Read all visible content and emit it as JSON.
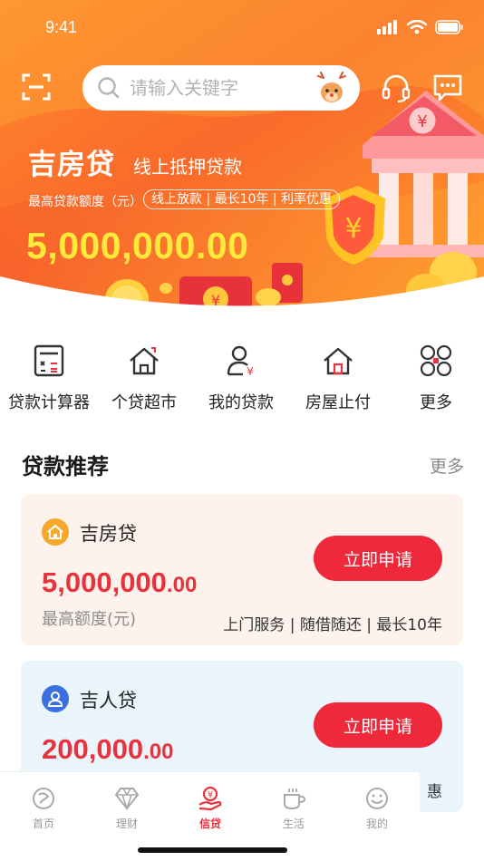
{
  "status_bar": {
    "time": "9:41"
  },
  "search": {
    "placeholder": "请输入关键字"
  },
  "hero": {
    "title": "吉房贷",
    "subtitle": "线上抵押贷款",
    "limit_label": "最高贷款额度（元）",
    "tags": "线上放款 | 最长10年 | 利率优惠",
    "amount": "5,000,000.00"
  },
  "quick_nav": [
    {
      "label": "贷款计算器",
      "icon": "calculator-icon"
    },
    {
      "label": "个贷超市",
      "icon": "house-icon"
    },
    {
      "label": "我的贷款",
      "icon": "user-yuan-icon"
    },
    {
      "label": "房屋止付",
      "icon": "house-stop-icon"
    },
    {
      "label": "更多",
      "icon": "grid-icon"
    }
  ],
  "recommend": {
    "title": "贷款推荐",
    "more": "更多",
    "cards": [
      {
        "name": "吉房贷",
        "icon": "house-badge-icon",
        "amount_int": "5,000,000",
        "amount_dec": ".00",
        "limit_label": "最高额度(元)",
        "features": "上门服务 | 随借随还 | 最长10年",
        "button": "立即申请"
      },
      {
        "name": "吉人贷",
        "icon": "person-badge-icon",
        "amount_int": "200,000",
        "amount_dec": ".00",
        "features": "惠",
        "button": "立即申请"
      }
    ]
  },
  "tabbar": [
    {
      "label": "首页",
      "icon": "home-tab-icon"
    },
    {
      "label": "理财",
      "icon": "diamond-tab-icon"
    },
    {
      "label": "信贷",
      "icon": "loan-tab-icon",
      "active": true
    },
    {
      "label": "生活",
      "icon": "coffee-tab-icon"
    },
    {
      "label": "我的",
      "icon": "smile-tab-icon"
    }
  ],
  "colors": {
    "accent_red": "#f0283b",
    "amount_yellow": "#ffe93a",
    "hero_orange": "#f57a2a"
  }
}
